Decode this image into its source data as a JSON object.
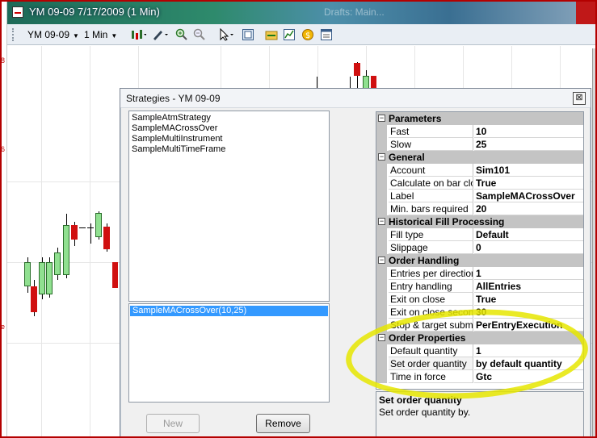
{
  "window": {
    "title": "YM 09-09  7/17/2009 (1 Min)",
    "ghost_title": "Drafts: Main...",
    "accent_red": "#c01818"
  },
  "toolbar": {
    "instrument": "YM 09-09",
    "interval": "1 Min",
    "icons": [
      "bar-chart-style-icon",
      "pencil-draw-icon",
      "zoom-in-icon",
      "zoom-out-icon",
      "cursor-pointer-icon",
      "data-box-icon",
      "instrument-folders-icon",
      "indicators-icon",
      "strategies-icon",
      "properties-icon"
    ]
  },
  "dialog": {
    "title": "Strategies - YM 09-09",
    "available_strategies": [
      "SampleAtmStrategy",
      "SampleMACrossOver",
      "SampleMultiInstrument",
      "SampleMultiTimeFrame"
    ],
    "configured_strategies": [
      "SampleMACrossOver(10,25)"
    ],
    "new_button": "New",
    "remove_button": "Remove",
    "categories": {
      "parameters": "Parameters",
      "general": "General",
      "historical": "Historical Fill Processing",
      "order_handling": "Order Handling",
      "order_properties": "Order Properties"
    },
    "props": {
      "fast": {
        "name": "Fast",
        "value": "10"
      },
      "slow": {
        "name": "Slow",
        "value": "25"
      },
      "account": {
        "name": "Account",
        "value": "Sim101"
      },
      "calc_on_bar_close": {
        "name": "Calculate on bar clos",
        "value": "True"
      },
      "label": {
        "name": "Label",
        "value": "SampleMACrossOver"
      },
      "min_bars": {
        "name": "Min. bars required",
        "value": "20"
      },
      "fill_type": {
        "name": "Fill type",
        "value": "Default"
      },
      "slippage": {
        "name": "Slippage",
        "value": "0"
      },
      "entries_per_direction": {
        "name": "Entries per direction",
        "value": "1"
      },
      "entry_handling": {
        "name": "Entry handling",
        "value": "AllEntries"
      },
      "exit_on_close": {
        "name": "Exit on close",
        "value": "True"
      },
      "exit_on_close_seconds": {
        "name": "Exit on close second",
        "value": "30"
      },
      "stop_target": {
        "name": "Stop & target submis",
        "value": "PerEntryExecution"
      },
      "default_quantity": {
        "name": "Default quantity",
        "value": "1"
      },
      "set_order_quantity": {
        "name": "Set order quantity",
        "value": "by default quantity"
      },
      "time_in_force": {
        "name": "Time in force",
        "value": "Gtc"
      }
    },
    "description": {
      "title": "Set order quantity",
      "text": "Set order quantity by."
    }
  },
  "colors": {
    "candle_up": "#90e090",
    "candle_down": "#d01010",
    "highlight": "#e6e600",
    "selection": "#3399ff"
  }
}
